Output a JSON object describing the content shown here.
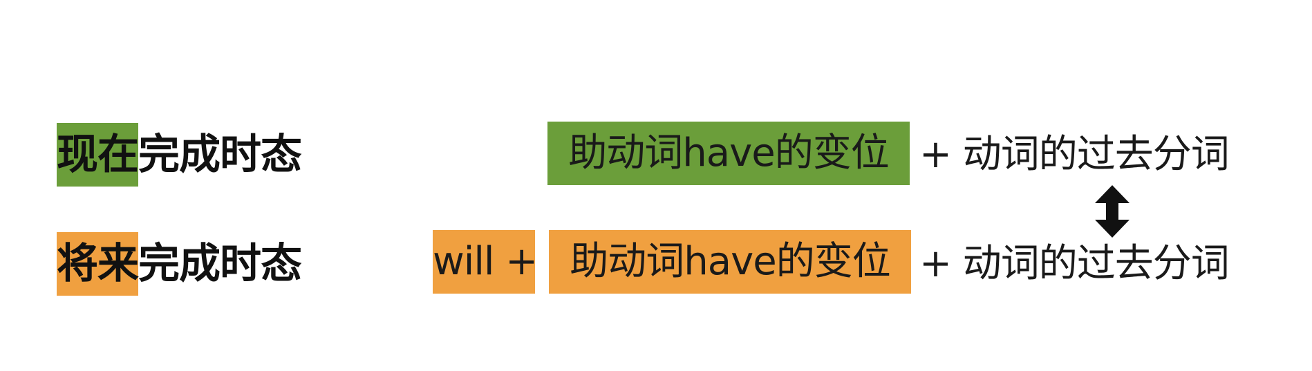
{
  "colors": {
    "green": "#6b9e3a",
    "orange": "#f0a040",
    "text": "#1a1a1a",
    "background": "#ffffff"
  },
  "row1": {
    "label_highlight": "现在",
    "label_rest": "完成时态",
    "aux_box": "助动词have的变位",
    "tail": "+ 动词的过去分词"
  },
  "row2": {
    "label_highlight": "将来",
    "label_rest": "完成时态",
    "will_box": "will +",
    "aux_box": "助动词have的变位",
    "tail": "+ 动词的过去分词"
  },
  "arrow_icon": "double-headed-vertical-arrow-icon"
}
